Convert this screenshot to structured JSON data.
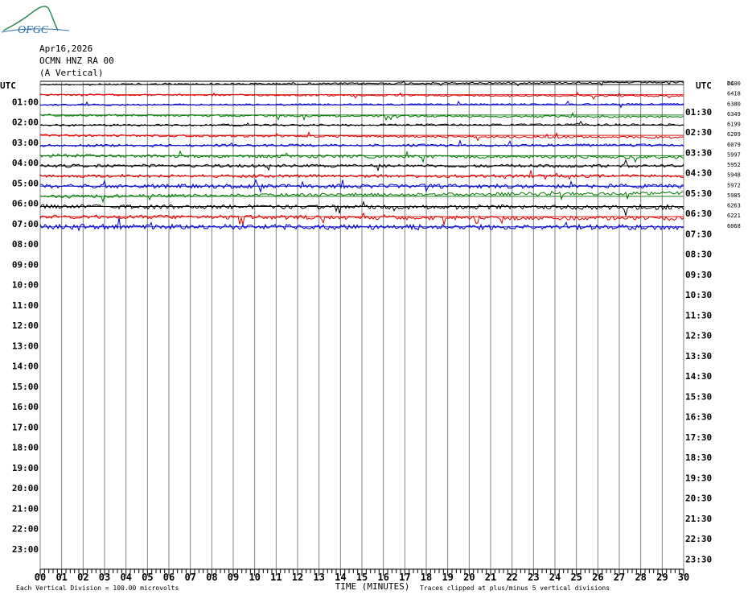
{
  "logo": {
    "text": "OFGC"
  },
  "header": {
    "date": "Apr16,2026",
    "station": "OCMN HNZ RA 00",
    "component": "(A Vertical)"
  },
  "axes": {
    "left_tz": "UTC",
    "right_tz": "UTC",
    "left_hours": [
      "01:00",
      "02:00",
      "03:00",
      "04:00",
      "05:00",
      "06:00",
      "07:00",
      "08:00",
      "09:00",
      "10:00",
      "11:00",
      "12:00",
      "13:00",
      "14:00",
      "15:00",
      "16:00",
      "17:00",
      "18:00",
      "19:00",
      "20:00",
      "21:00",
      "22:00",
      "23:00"
    ],
    "right_hours": [
      "01:30",
      "02:30",
      "03:30",
      "04:30",
      "05:30",
      "06:30",
      "07:30",
      "08:30",
      "09:30",
      "10:30",
      "11:30",
      "12:30",
      "13:30",
      "14:30",
      "15:30",
      "16:30",
      "17:30",
      "18:30",
      "19:30",
      "20:30",
      "21:30",
      "22:30",
      "23:30"
    ],
    "minute_ticks": [
      "00",
      "01",
      "02",
      "03",
      "04",
      "05",
      "06",
      "07",
      "08",
      "09",
      "10",
      "11",
      "12",
      "13",
      "14",
      "15",
      "16",
      "17",
      "18",
      "19",
      "20",
      "21",
      "22",
      "23",
      "24",
      "25",
      "26",
      "27",
      "28",
      "29",
      "30"
    ],
    "xlabel": "TIME (MINUTES)"
  },
  "footer": {
    "division_note": "Each Vertical Division =  100.00 microvolts",
    "clip_note": "Traces clipped at plus/minus 5 vertical divisions"
  },
  "colors": {
    "black": "#000000",
    "red": "#dd0000",
    "blue": "#0000cc",
    "green": "#007700",
    "grid": "#808080"
  },
  "chart_data": {
    "type": "line",
    "title": "Apr16,2026 OCMN HNZ RA 00 (A Vertical)",
    "xlabel": "TIME (MINUTES)",
    "x_range": [
      0,
      30
    ],
    "rows_total": 48,
    "rows_recorded": 15,
    "dc_header": "DC",
    "dc_offsets": [
      "6400",
      "6418",
      "6380",
      "6349",
      "6199",
      "6209",
      "6079",
      "5997",
      "5952",
      "5948",
      "5972",
      "5985",
      "6263",
      "6221",
      "6068"
    ],
    "trace_colors": [
      "black",
      "red",
      "blue",
      "green",
      "black",
      "red",
      "blue",
      "green",
      "black",
      "red",
      "blue",
      "green",
      "black",
      "red",
      "blue"
    ],
    "trace_drift": [
      -0.6,
      0.35,
      -0.2,
      0.55,
      -0.15,
      0.6,
      -0.1,
      0.45,
      0,
      0,
      0,
      -0.9,
      0.3,
      0.5,
      0.1
    ],
    "trace_noise": [
      0.08,
      0.08,
      0.08,
      0.1,
      0.1,
      0.1,
      0.12,
      0.15,
      0.15,
      0.15,
      0.2,
      0.15,
      0.2,
      0.2,
      0.25
    ]
  }
}
